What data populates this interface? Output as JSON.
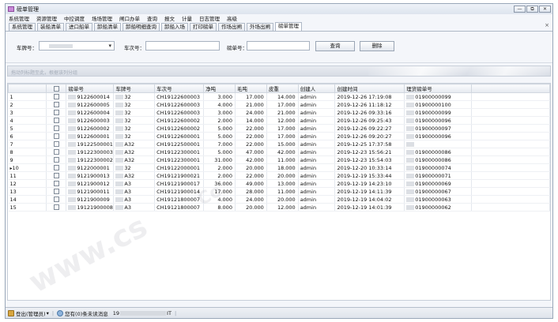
{
  "window": {
    "title": "磅单管理",
    "buttons": [
      "—",
      "⧉",
      "✕"
    ]
  },
  "menu": [
    "系统管理",
    "资源管理",
    "中控调度",
    "场场管理",
    "闸口办单",
    "查询",
    "报文",
    "计量",
    "日志管理",
    "高级"
  ],
  "tabs": [
    {
      "label": "系统管理",
      "active": false
    },
    {
      "label": "装船清单",
      "active": false
    },
    {
      "label": "进口船单",
      "active": false
    },
    {
      "label": "卸船清单",
      "active": false
    },
    {
      "label": "卸船明细查询",
      "active": false
    },
    {
      "label": "卸船入场",
      "active": false
    },
    {
      "label": "打印磅单",
      "active": false
    },
    {
      "label": "作场出闸",
      "active": false
    },
    {
      "label": "外场出闸",
      "active": false
    },
    {
      "label": "磅单管理",
      "active": true
    }
  ],
  "tab_close": "×",
  "filter": {
    "plate_label": "车牌号：",
    "trip_label": "车次号：",
    "ticket_label": "磅单号：",
    "query_button": "查询",
    "delete_button": "删除"
  },
  "group_hint": "拖动列标题至此，根据该列分组",
  "table": {
    "columns": [
      "",
      "",
      "磅单号",
      "车牌号",
      "车次号",
      "净吨",
      "毛吨",
      "皮重",
      "创建人",
      "创建时间",
      "理货磅单号"
    ],
    "current_row": 9,
    "rows": [
      [
        "1",
        "9122600014",
        "32",
        "CH19122600003",
        "3.000",
        "17.000",
        "14.000",
        "admin",
        "2019-12-26 17:19:08",
        "01900000099"
      ],
      [
        "2",
        "9122600005",
        "32",
        "CH19122600003",
        "4.000",
        "21.000",
        "17.000",
        "admin",
        "2019-12-26 11:18:12",
        "01900000100"
      ],
      [
        "3",
        "9122600004",
        "32",
        "CH19122600003",
        "3.000",
        "24.000",
        "21.000",
        "admin",
        "2019-12-26 09:33:16",
        "01900000099"
      ],
      [
        "4",
        "9122600003",
        "32",
        "CH19122600002",
        "2.000",
        "14.000",
        "12.000",
        "admin",
        "2019-12-26 09:25:43",
        "01900000096"
      ],
      [
        "5",
        "9122600002",
        "32",
        "CH19122600002",
        "5.000",
        "22.000",
        "17.000",
        "admin",
        "2019-12-26 09:22:27",
        "01900000097"
      ],
      [
        "6",
        "9122600001",
        "32",
        "CH19122600001",
        "5.000",
        "22.000",
        "17.000",
        "admin",
        "2019-12-26 09:20:27",
        "01900000096"
      ],
      [
        "7",
        "19122500001",
        "A32",
        "CH19122500001",
        "7.000",
        "22.000",
        "15.000",
        "admin",
        "2019-12-25 17:37:58",
        ""
      ],
      [
        "8",
        "19122300003",
        "A32",
        "CH19122300001",
        "5.000",
        "47.000",
        "42.000",
        "admin",
        "2019-12-23 15:56:21",
        "01900000086"
      ],
      [
        "9",
        "19122300002",
        "A32",
        "CH19122300001",
        "31.000",
        "42.000",
        "11.000",
        "admin",
        "2019-12-23 15:54:03",
        "01900000086"
      ],
      [
        "10",
        "9122000001",
        "32",
        "CH19122000001",
        "2.000",
        "20.000",
        "18.000",
        "admin",
        "2019-12-20 10:33:14",
        "01900000074"
      ],
      [
        "11",
        "9121900013",
        "A32",
        "CH19121900021",
        "2.000",
        "22.000",
        "20.000",
        "admin",
        "2019-12-19 15:33:44",
        "01900000071"
      ],
      [
        "12",
        "9121900012",
        "A3",
        "CH19121900017",
        "36.000",
        "49.000",
        "13.000",
        "admin",
        "2019-12-19 14:23:10",
        "01900000069"
      ],
      [
        "13",
        "9121900011",
        "A3",
        "CH19121900014",
        "17.000",
        "28.000",
        "11.000",
        "admin",
        "2019-12-19 14:11:39",
        "01900000067"
      ],
      [
        "14",
        "9121900009",
        "A3",
        "CH19121800007",
        "4.000",
        "24.000",
        "20.000",
        "admin",
        "2019-12-19 14:04:02",
        "01900000063"
      ],
      [
        "15",
        "19121900008",
        "A3",
        "CH19121800007",
        "8.000",
        "20.000",
        "12.000",
        "admin",
        "2019-12-19 14:01:39",
        "01900000062"
      ]
    ]
  },
  "status": {
    "login": "登出(管理员)",
    "login_arrow": "▾",
    "messages": "您有(0)条未读消息",
    "ip_prefix": "19",
    "ip_suffix": "IT"
  },
  "watermarks": [
    "www.cs",
    "Co"
  ]
}
